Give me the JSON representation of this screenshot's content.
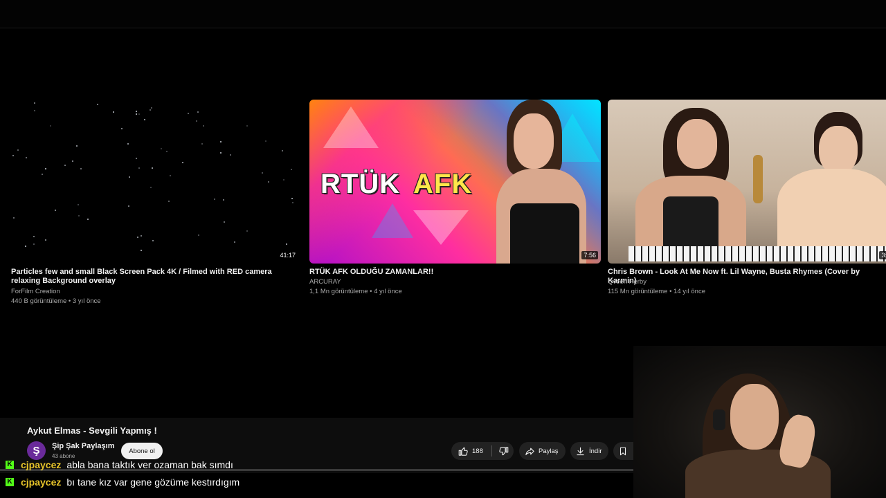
{
  "videos": [
    {
      "title": "Particles few and small Black Screen Pack 4K / Filmed with RED camera relaxing Background overlay",
      "channel": "ForFilm Creation",
      "meta": "440 B görüntüleme • 3 yıl önce",
      "duration": "41:17"
    },
    {
      "title": "RTÜK AFK OLDUĞU ZAMANLAR!!",
      "channel": "ARCURAY",
      "meta": "1,1 Mn görüntüleme • 4 yıl önce",
      "duration": "7:56",
      "thumb_text_left": "RTÜK",
      "thumb_text_right": "AFK"
    },
    {
      "title": "Chris Brown - Look At Me Now ft. Lil Wayne, Busta Rhymes (Cover by Karmin)",
      "channel": "Qveen Herby",
      "meta": "115 Mn görüntüleme • 14 yıl önce",
      "duration": "3:"
    }
  ],
  "player": {
    "title": "Aykut Elmas - Sevgili Yapmış !",
    "channel_initial": "Ş",
    "channel_name": "Şip Şak Paylaşım",
    "subscribers": "43 abone",
    "subscribe_label": "Abone ol",
    "likes": "188",
    "share_label": "Paylaş",
    "download_label": "İndir",
    "progress_fraction": 0.0
  },
  "chat": [
    {
      "user": "cjpaycez",
      "message": "abla bana taktık ver ozaman bak sımdı"
    },
    {
      "user": "cjpaycez",
      "message": "bı tane kız var gene gözüme kestırdıgım"
    }
  ],
  "colors": {
    "chat_user": "#e8c52a",
    "kick_badge": "#53fc18",
    "channel_avatar": "#6a2a9a"
  },
  "icons": {
    "kick_badge": "K",
    "like": "thumbs-up-icon",
    "dislike": "thumbs-down-icon",
    "share": "share-icon",
    "download": "download-icon",
    "save": "bookmark-icon"
  }
}
